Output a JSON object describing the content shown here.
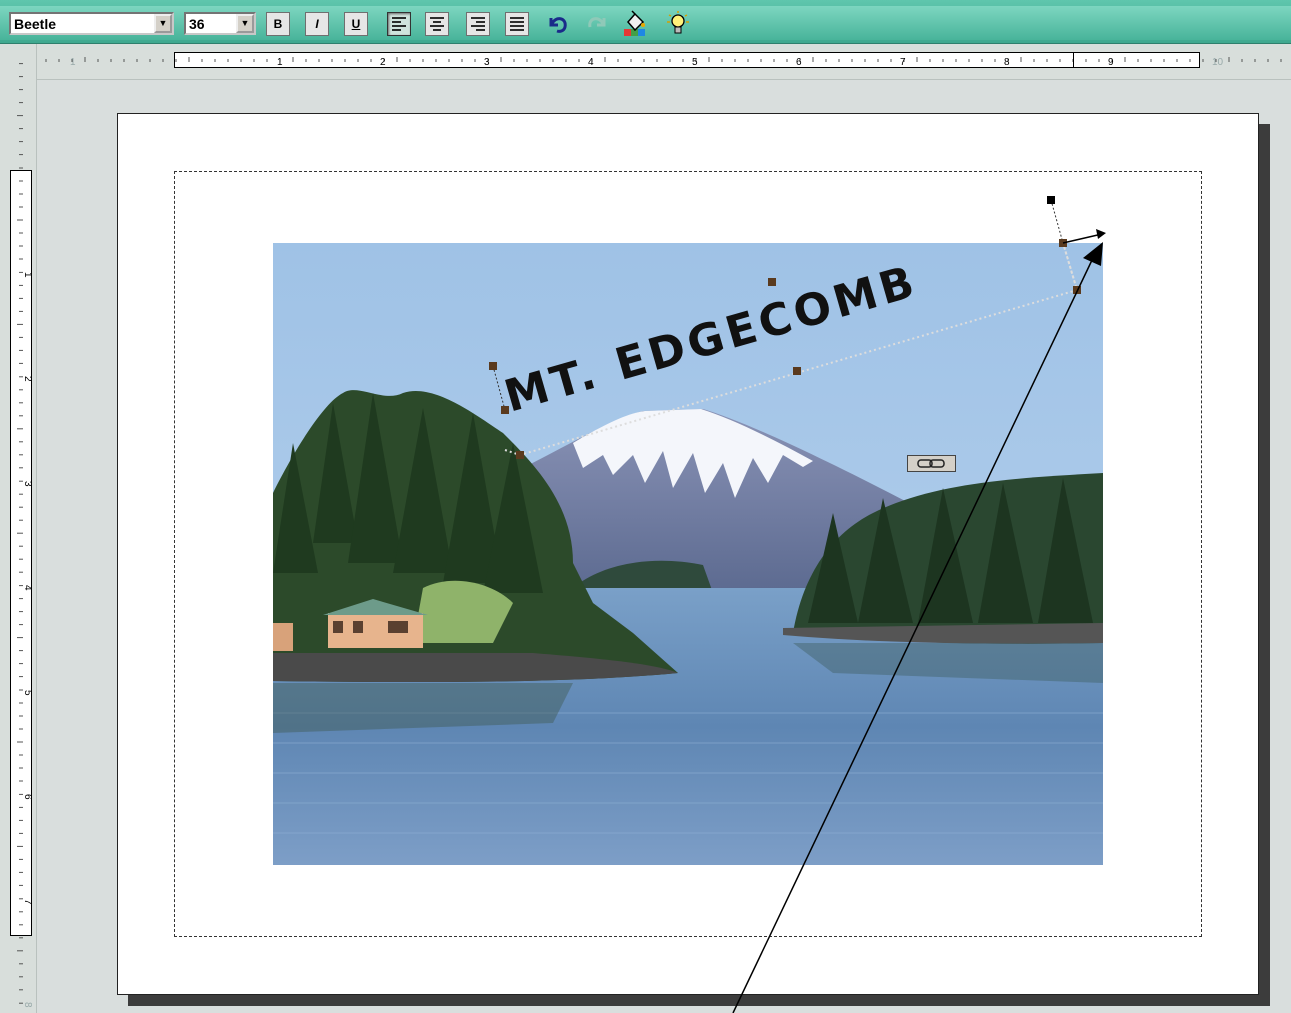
{
  "toolbar": {
    "font_name": "Beetle",
    "font_size": "36",
    "bold_label": "B",
    "italic_label": "I",
    "underline_label": "U",
    "icons": [
      "align-left-icon",
      "align-center-icon",
      "align-right-icon",
      "justify-icon",
      "undo-icon",
      "redo-icon",
      "fill-color-icon",
      "tip-lightbulb-icon"
    ]
  },
  "ruler": {
    "horizontal_numbers": [
      "1",
      "1",
      "2",
      "3",
      "4",
      "5",
      "6",
      "7",
      "8",
      "9",
      "10"
    ],
    "vertical_numbers": [
      "1",
      "2",
      "3",
      "4",
      "5",
      "6",
      "7",
      "8"
    ]
  },
  "document": {
    "wordart_text": "MT. EDGECOMB",
    "photo_subject": "mountain-lake-photo"
  },
  "colors": {
    "toolbar": "#4fb89e",
    "selection_handle": "#5a3a1e",
    "page_background": "#ffffff"
  }
}
